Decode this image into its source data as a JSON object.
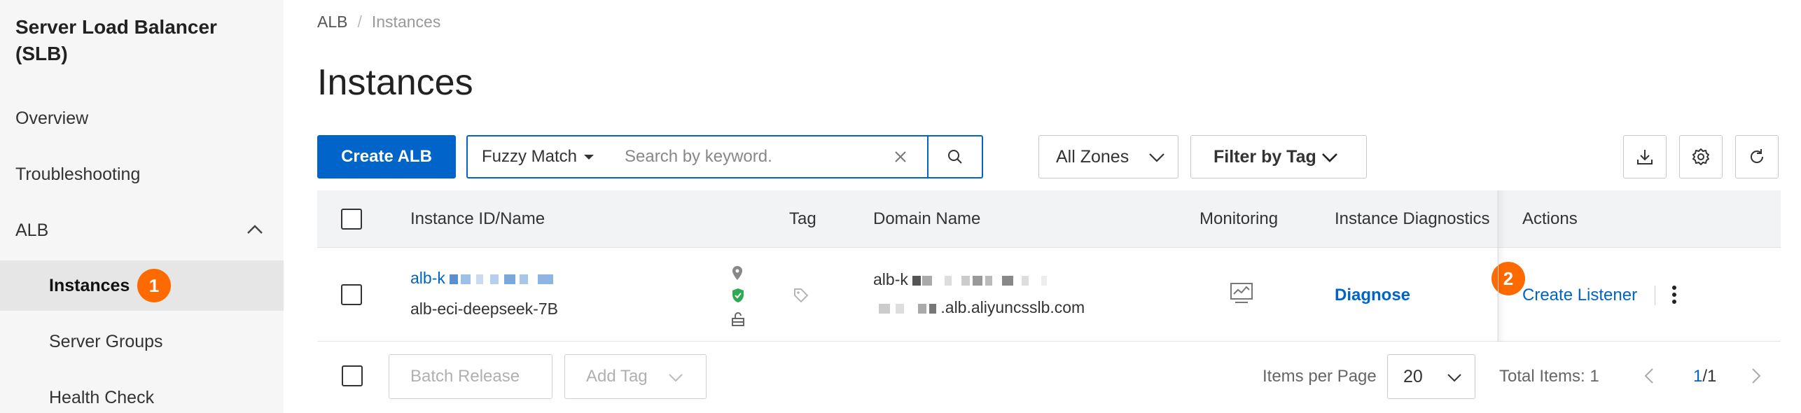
{
  "sidebar": {
    "title": "Server Load Balancer (SLB)",
    "items": [
      {
        "label": "Overview"
      },
      {
        "label": "Troubleshooting"
      },
      {
        "label": "ALB"
      },
      {
        "label": "Instances"
      },
      {
        "label": "Server Groups"
      },
      {
        "label": "Health Check"
      }
    ],
    "step_badge_1": "1"
  },
  "breadcrumb": {
    "root": "ALB",
    "separator": "/",
    "current": "Instances"
  },
  "page_title": "Instances",
  "toolbar": {
    "create_label": "Create ALB",
    "match_mode": "Fuzzy Match",
    "search_placeholder": "Search by keyword.",
    "zones_label": "All Zones",
    "filter_tag_label": "Filter by Tag"
  },
  "table": {
    "headers": {
      "instance": "Instance ID/Name",
      "tag": "Tag",
      "domain": "Domain Name",
      "monitoring": "Monitoring",
      "diagnostics": "Instance Diagnostics",
      "actions": "Actions"
    },
    "rows": [
      {
        "instance_id_prefix": "alb-k",
        "instance_name": "alb-eci-deepseek-7B",
        "domain_line1_prefix": "alb-k",
        "domain_line2_suffix": ".alb.aliyuncsslb.com",
        "diagnose_label": "Diagnose",
        "create_listener_label": "Create Listener",
        "step_badge_2": "2"
      }
    ]
  },
  "footer": {
    "batch_release_label": "Batch Release",
    "add_tag_label": "Add Tag",
    "items_per_page_label": "Items per Page",
    "page_size": "20",
    "total_items": "Total Items: 1",
    "page_current": "1",
    "page_total": "/1"
  },
  "colors": {
    "primary": "#0064c8",
    "step_badge": "#ff6a00",
    "sidebar_bg": "#f6f6f6",
    "sidebar_active_bg": "#e6e6e6",
    "table_header_bg": "#f2f3f5"
  }
}
